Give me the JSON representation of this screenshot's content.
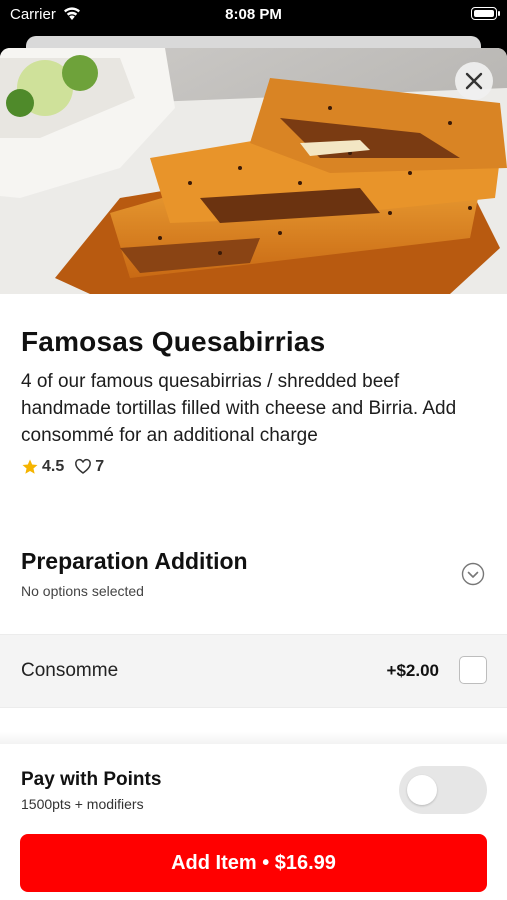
{
  "status_bar": {
    "carrier": "Carrier",
    "time": "8:08 PM"
  },
  "item": {
    "title": "Famosas Quesabirrias",
    "description": "4 of our famous quesabirrias / shredded beef handmade tortillas filled with cheese and Birria. Add consommé for an additional charge",
    "rating": "4.5",
    "likes": "7"
  },
  "preparation": {
    "title": "Preparation Addition",
    "subtitle": "No options selected",
    "options": [
      {
        "name": "Consomme",
        "price": "+$2.00",
        "checked": false
      }
    ]
  },
  "points": {
    "title": "Pay with Points",
    "subtitle": "1500pts + modifiers",
    "enabled": false
  },
  "add_button": {
    "label": "Add Item • $16.99"
  },
  "colors": {
    "accent": "#ff0000",
    "star": "#f5b400",
    "toggle_off": "#e6e6e6"
  },
  "icons": [
    "wifi-icon",
    "battery-icon",
    "close-icon",
    "star-icon",
    "heart-icon",
    "chevron-down-icon"
  ]
}
